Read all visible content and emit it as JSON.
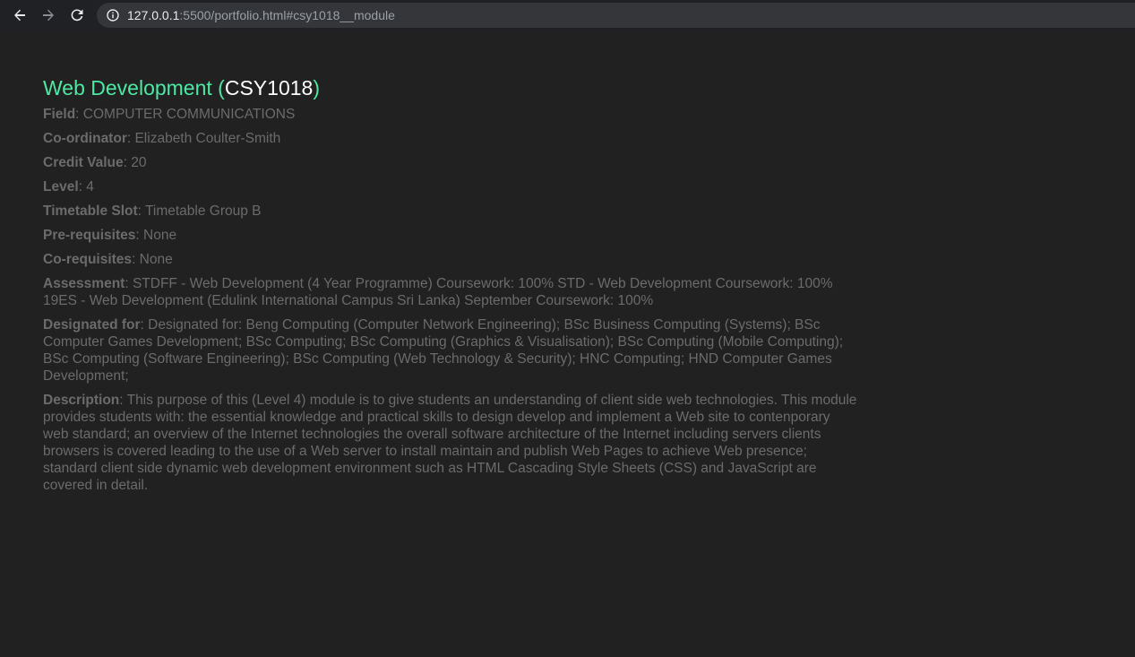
{
  "browser": {
    "url_host": "127.0.0.1",
    "url_rest": ":5500/portfolio.html#csy1018__module"
  },
  "module": {
    "name": "Web Development",
    "open_paren": " (",
    "code": "CSY1018",
    "close_paren": ")"
  },
  "fields": [
    {
      "label": "Field",
      "value": ": COMPUTER COMMUNICATIONS"
    },
    {
      "label": "Co-ordinator",
      "value": ": Elizabeth Coulter-Smith"
    },
    {
      "label": "Credit Value",
      "value": ": 20"
    },
    {
      "label": "Level",
      "value": ": 4"
    },
    {
      "label": "Timetable Slot",
      "value": ": Timetable Group B"
    },
    {
      "label": "Pre-requisites",
      "value": ": None"
    },
    {
      "label": "Co-requisites",
      "value": ": None"
    },
    {
      "label": "Assessment",
      "value": ": STDFF - Web Development (4 Year Programme) Coursework: 100% STD - Web Development Coursework: 100% 19ES - Web Development (Edulink International Campus Sri Lanka) September Coursework: 100%"
    },
    {
      "label": "Designated for",
      "value": ": Designated for: Beng Computing (Computer Network Engineering); BSc Business Computing (Systems); BSc Computer Games Development; BSc Computing; BSc Computing (Graphics & Visualisation); BSc Computing (Mobile Computing); BSc Computing (Software Engineering); BSc Computing (Web Technology & Security); HNC Computing; HND Computer Games Development;"
    },
    {
      "label": "Description",
      "value": ": This purpose of this (Level 4) module is to give students an understanding of client side web technologies. This module provides students with: the essential knowledge and practical skills to design develop and implement a Web site to contenporary web standard; an overview of the Internet technologies the overall software architecture of the Internet including servers clients browsers is covered leading to the use of a Web server to install maintain and publish Web Pages to achieve Web presence; standard client side dynamic web development environment such as HTML Cascading Style Sheets (CSS) and JavaScript are covered in detail."
    }
  ],
  "colors": {
    "background": "#212121",
    "title_accent": "#4de8a3",
    "text": "#6b6b6b"
  }
}
